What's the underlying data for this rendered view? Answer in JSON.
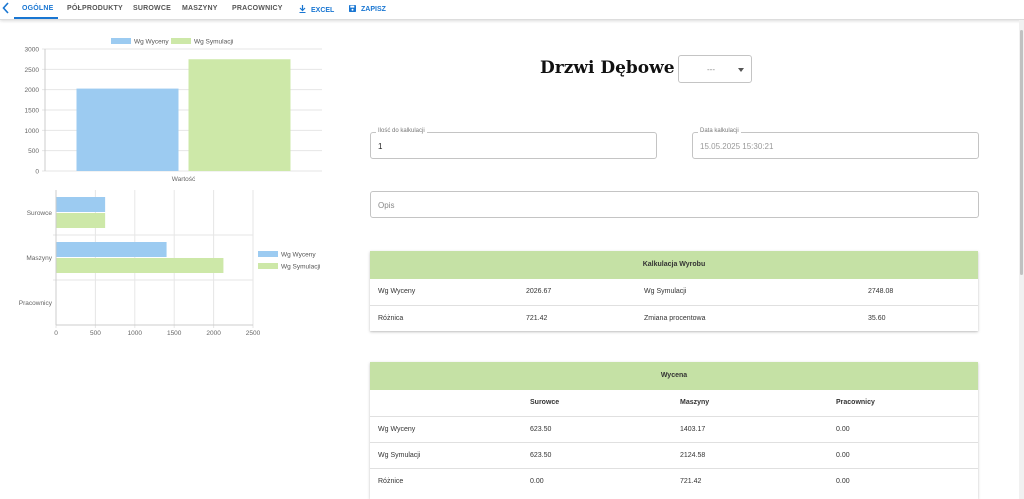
{
  "nav": {
    "tabs": [
      {
        "label": "OGÓLNE",
        "active": true
      },
      {
        "label": "PÓŁPRODUKTY",
        "active": false
      },
      {
        "label": "SUROWCE",
        "active": false
      },
      {
        "label": "MASZYNY",
        "active": false
      },
      {
        "label": "PRACOWNICY",
        "active": false
      }
    ],
    "excel_label": "EXCEL",
    "save_label": "ZAPISZ",
    "accent": "#1976d2"
  },
  "product": {
    "title": "Drzwi Dębowe",
    "variant_value": "---"
  },
  "form": {
    "qty_label": "Ilość do kalkulacji",
    "qty_value": "1",
    "date_label": "Data kalkulacji",
    "date_value": "15.05.2025 15:30:21",
    "desc_placeholder": "Opis"
  },
  "calc_card": {
    "title": "Kalkulacja Wyrobu",
    "rows": [
      [
        "Wg Wyceny",
        "2026.67",
        "Wg Symulacji",
        "2748.08"
      ],
      [
        "Różnica",
        "721.42",
        "Zmiana procentowa",
        "35.60"
      ]
    ]
  },
  "pricing_card": {
    "title": "Wycena",
    "headers": [
      "",
      "Surowce",
      "Maszyny",
      "Pracownicy"
    ],
    "rows": [
      [
        "Wg Wyceny",
        "623.50",
        "1403.17",
        "0.00"
      ],
      [
        "Wg Symulacji",
        "623.50",
        "2124.58",
        "0.00"
      ],
      [
        "Różnice",
        "0.00",
        "721.42",
        "0.00"
      ]
    ]
  },
  "chart_data": [
    {
      "type": "bar",
      "categories": [
        "Wartość"
      ],
      "series": [
        {
          "name": "Wg Wyceny",
          "values": [
            2026.67
          ],
          "color": "#9ccbf1"
        },
        {
          "name": "Wg Symulacji",
          "values": [
            2748.08
          ],
          "color": "#cde8a8"
        }
      ],
      "yticks": [
        "0",
        "500",
        "1000",
        "1500",
        "2000",
        "2500",
        "3000"
      ],
      "ylim": [
        0,
        3000
      ],
      "grid": true,
      "legend": "top"
    },
    {
      "type": "bar",
      "orientation": "horizontal",
      "categories": [
        "Surowce",
        "Maszyny",
        "Pracownicy"
      ],
      "series": [
        {
          "name": "Wg Wyceny",
          "values": [
            623.5,
            1403.17,
            0
          ],
          "color": "#9ccbf1"
        },
        {
          "name": "Wg Symulacji",
          "values": [
            623.5,
            2124.58,
            0
          ],
          "color": "#cde8a8"
        }
      ],
      "xticks": [
        "0",
        "500",
        "1000",
        "1500",
        "2000",
        "2500"
      ],
      "xlim": [
        0,
        2500
      ],
      "grid": true,
      "legend": "right"
    }
  ]
}
